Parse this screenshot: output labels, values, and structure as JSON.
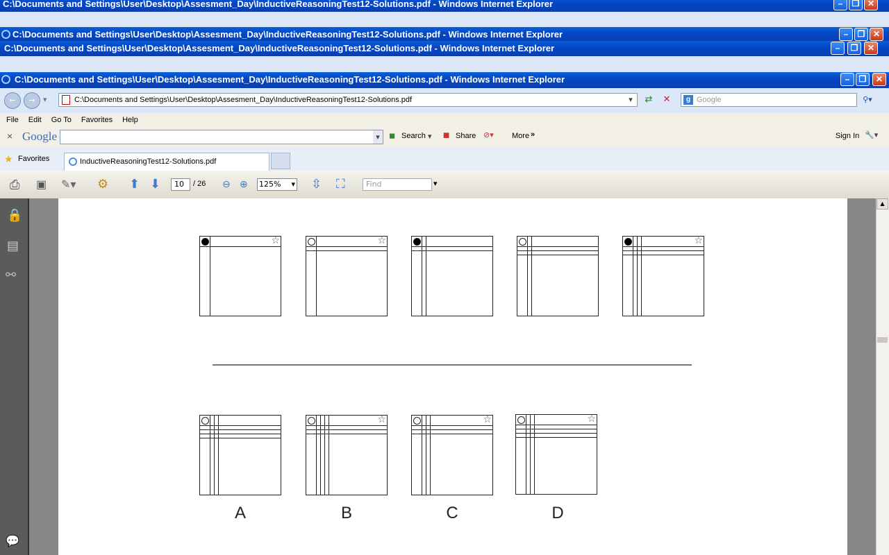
{
  "windows": {
    "title": "C:\\Documents and Settings\\User\\Desktop\\Assesment_Day\\InductiveReasoningTest12-Solutions.pdf - Windows Internet Explorer"
  },
  "address": {
    "url": "C:\\Documents and Settings\\User\\Desktop\\Assesment_Day\\InductiveReasoningTest12-Solutions.pdf",
    "search_placeholder": "Google"
  },
  "menu": [
    "File",
    "Edit",
    "Go To",
    "Favorites",
    "Help"
  ],
  "google_toolbar": {
    "logo": "Google",
    "search_label": "Search",
    "share_label": "Share",
    "more_label": "More",
    "signin_label": "Sign In"
  },
  "favorites": {
    "label": "Favorites",
    "tab_title": "InductiveReasoningTest12-Solutions.pdf"
  },
  "pdf_toolbar": {
    "page_current": "10",
    "page_total": "/ 26",
    "zoom": "125%",
    "find_placeholder": "Find"
  },
  "puzzle": {
    "options": [
      "A",
      "B",
      "C",
      "D"
    ],
    "sequence_dots": [
      "filled",
      "empty",
      "filled",
      "empty",
      "filled"
    ],
    "sequence_stars": [
      true,
      true,
      false,
      false,
      true
    ],
    "option_stars": [
      false,
      true,
      true,
      true
    ]
  }
}
